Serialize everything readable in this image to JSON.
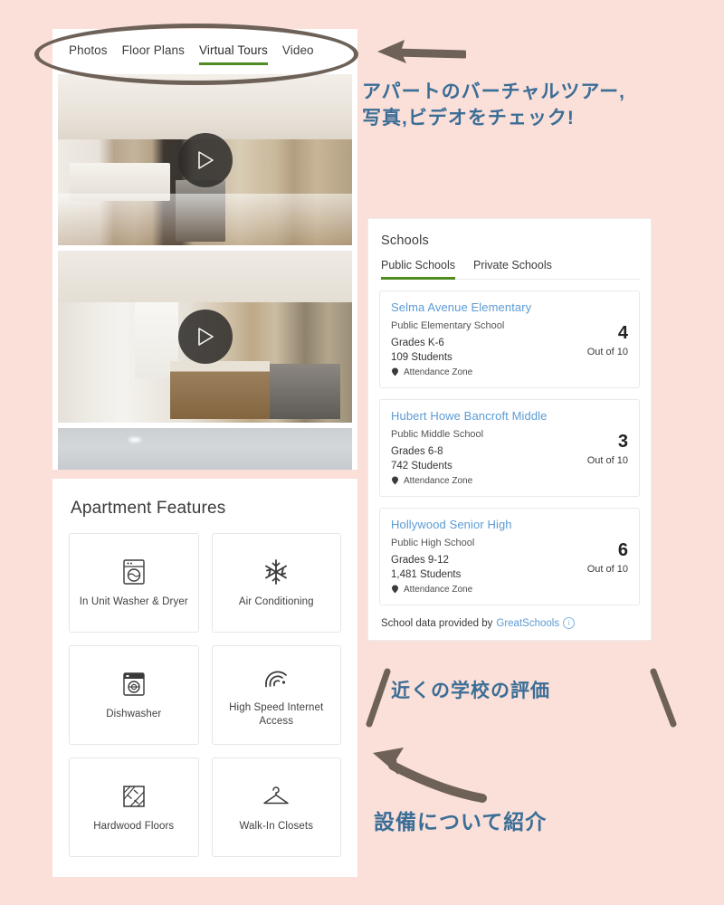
{
  "page": {
    "background_color": "#fbdfd9",
    "annotation_color": "#3b6e96",
    "arrow_color": "#6e6258",
    "accent_green": "#4f8a22",
    "link_blue": "#5b9bd5"
  },
  "media_tabs": {
    "items": [
      {
        "label": "Photos",
        "active": false
      },
      {
        "label": "Floor Plans",
        "active": false
      },
      {
        "label": "Virtual Tours",
        "active": true
      },
      {
        "label": "Video",
        "active": false
      }
    ]
  },
  "media": {
    "items": [
      {
        "name": "kitchen-galley-tour",
        "has_play_button": true
      },
      {
        "name": "open-kitchen-living-tour",
        "has_play_button": true
      },
      {
        "name": "ceiling-partial-tour",
        "has_play_button": false
      }
    ]
  },
  "features": {
    "title": "Apartment Features",
    "items": [
      {
        "label": "In Unit Washer & Dryer",
        "icon": "washer-dryer-icon"
      },
      {
        "label": "Air Conditioning",
        "icon": "snowflake-icon"
      },
      {
        "label": "Dishwasher",
        "icon": "dishwasher-icon"
      },
      {
        "label": "High Speed Internet Access",
        "icon": "wifi-signal-icon"
      },
      {
        "label": "Hardwood Floors",
        "icon": "hardwood-floor-icon"
      },
      {
        "label": "Walk-In Closets",
        "icon": "clothes-hanger-icon"
      }
    ]
  },
  "schools": {
    "title": "Schools",
    "tabs": [
      {
        "label": "Public Schools",
        "active": true
      },
      {
        "label": "Private Schools",
        "active": false
      }
    ],
    "cards": [
      {
        "name": "Selma Avenue Elementary",
        "type": "Public Elementary School",
        "grades": "Grades K-6",
        "students": "109 Students",
        "zone": "Attendance Zone",
        "rating": "4",
        "rating_out_of": "Out of 10"
      },
      {
        "name": "Hubert Howe Bancroft Middle",
        "type": "Public Middle School",
        "grades": "Grades 6-8",
        "students": "742 Students",
        "zone": "Attendance Zone",
        "rating": "3",
        "rating_out_of": "Out of 10"
      },
      {
        "name": "Hollywood Senior High",
        "type": "Public High School",
        "grades": "Grades 9-12",
        "students": "1,481 Students",
        "zone": "Attendance Zone",
        "rating": "6",
        "rating_out_of": "Out of 10"
      }
    ],
    "footer_text": "School data provided by",
    "footer_link": "GreatSchools",
    "footer_info_icon": "info-icon"
  },
  "annotations": {
    "virtual_tours": "アパートのバーチャルツアー,\n写真,ビデオをチェック!",
    "schools_rating": "近くの学校の評価",
    "amenities": "設備について紹介"
  }
}
